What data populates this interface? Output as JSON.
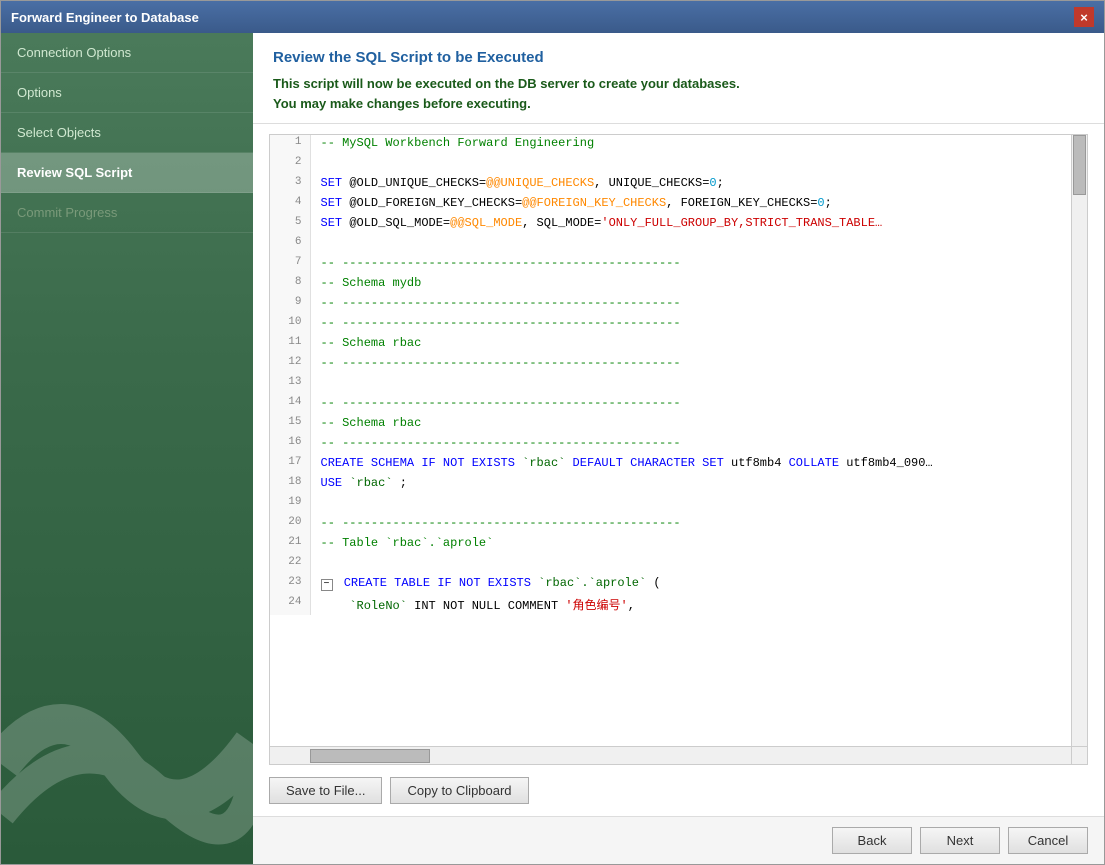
{
  "titleBar": {
    "title": "Forward Engineer to Database",
    "closeLabel": "×"
  },
  "sidebar": {
    "items": [
      {
        "id": "connection-options",
        "label": "Connection Options",
        "state": "normal"
      },
      {
        "id": "options",
        "label": "Options",
        "state": "normal"
      },
      {
        "id": "select-objects",
        "label": "Select Objects",
        "state": "normal"
      },
      {
        "id": "review-sql-script",
        "label": "Review SQL Script",
        "state": "active"
      },
      {
        "id": "commit-progress",
        "label": "Commit Progress",
        "state": "disabled"
      }
    ]
  },
  "main": {
    "header": {
      "title": "Review the SQL Script to be Executed",
      "description1": "This script will now be executed on the DB server to create your databases.",
      "description2": "You may make changes before executing."
    },
    "buttons": {
      "saveToFile": "Save to File...",
      "copyToClipboard": "Copy to Clipboard"
    },
    "footer": {
      "back": "Back",
      "next": "Next",
      "cancel": "Cancel"
    }
  }
}
